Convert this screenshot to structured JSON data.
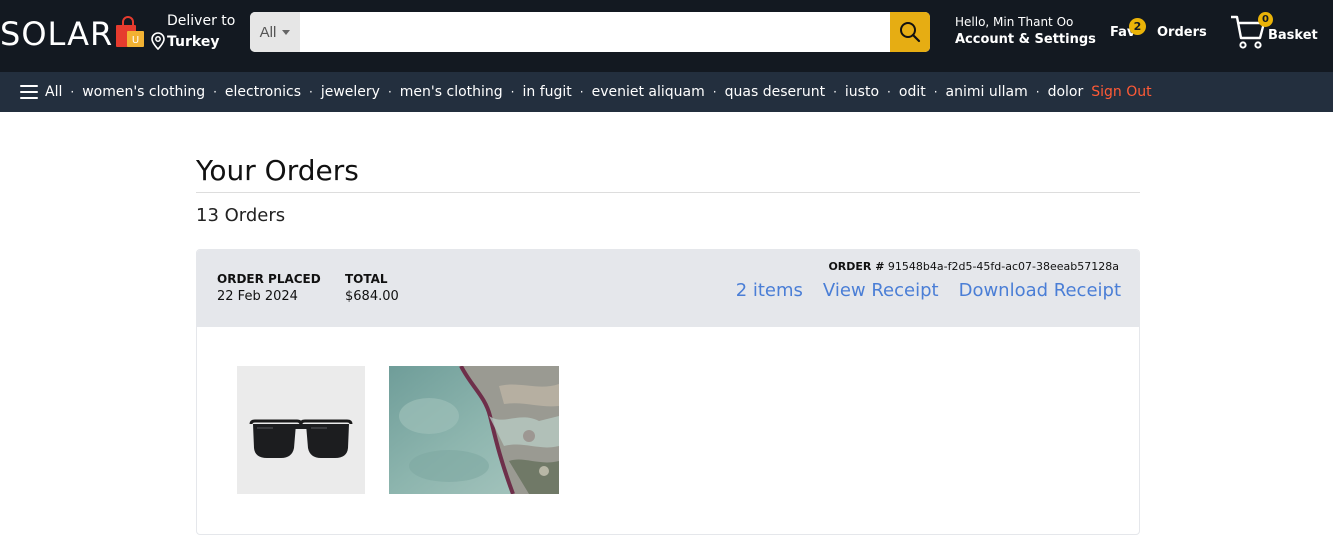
{
  "header": {
    "logo_text": "SOLAR",
    "logo_bag_letter": "U",
    "deliver_label": "Deliver to",
    "deliver_country": "Turkey",
    "search": {
      "category": "All",
      "value": "",
      "placeholder": ""
    },
    "greeting": "Hello, Min Thant Oo",
    "account_label": "Account & Settings",
    "fav_label": "Fav",
    "fav_count": "2",
    "orders_label": "Orders",
    "basket_label": "Basket",
    "basket_count": "0"
  },
  "nav": {
    "all_label": "All",
    "categories": [
      "women's clothing",
      "electronics",
      "jewelery",
      "men's clothing",
      "in fugit",
      "eveniet aliquam",
      "quas deserunt",
      "iusto",
      "odit",
      "animi ullam",
      "dolor"
    ],
    "sign_out": "Sign Out"
  },
  "page": {
    "title": "Your Orders",
    "count": "13 Orders"
  },
  "order": {
    "placed_label": "ORDER PLACED",
    "placed_date": "22 Feb 2024",
    "total_label": "TOTAL",
    "total_value": "$684.00",
    "id_label": "ORDER #",
    "id_value": "91548b4a-f2d5-45fd-ac07-38eeab57128a",
    "items_link": "2 items",
    "view_receipt": "View Receipt",
    "download_receipt": "Download Receipt"
  },
  "colors": {
    "header_bg": "#131921",
    "nav_bg": "#232f3e",
    "accent": "#e6ad13",
    "link": "#4a7ed6",
    "sign_out": "#ff5a36"
  }
}
